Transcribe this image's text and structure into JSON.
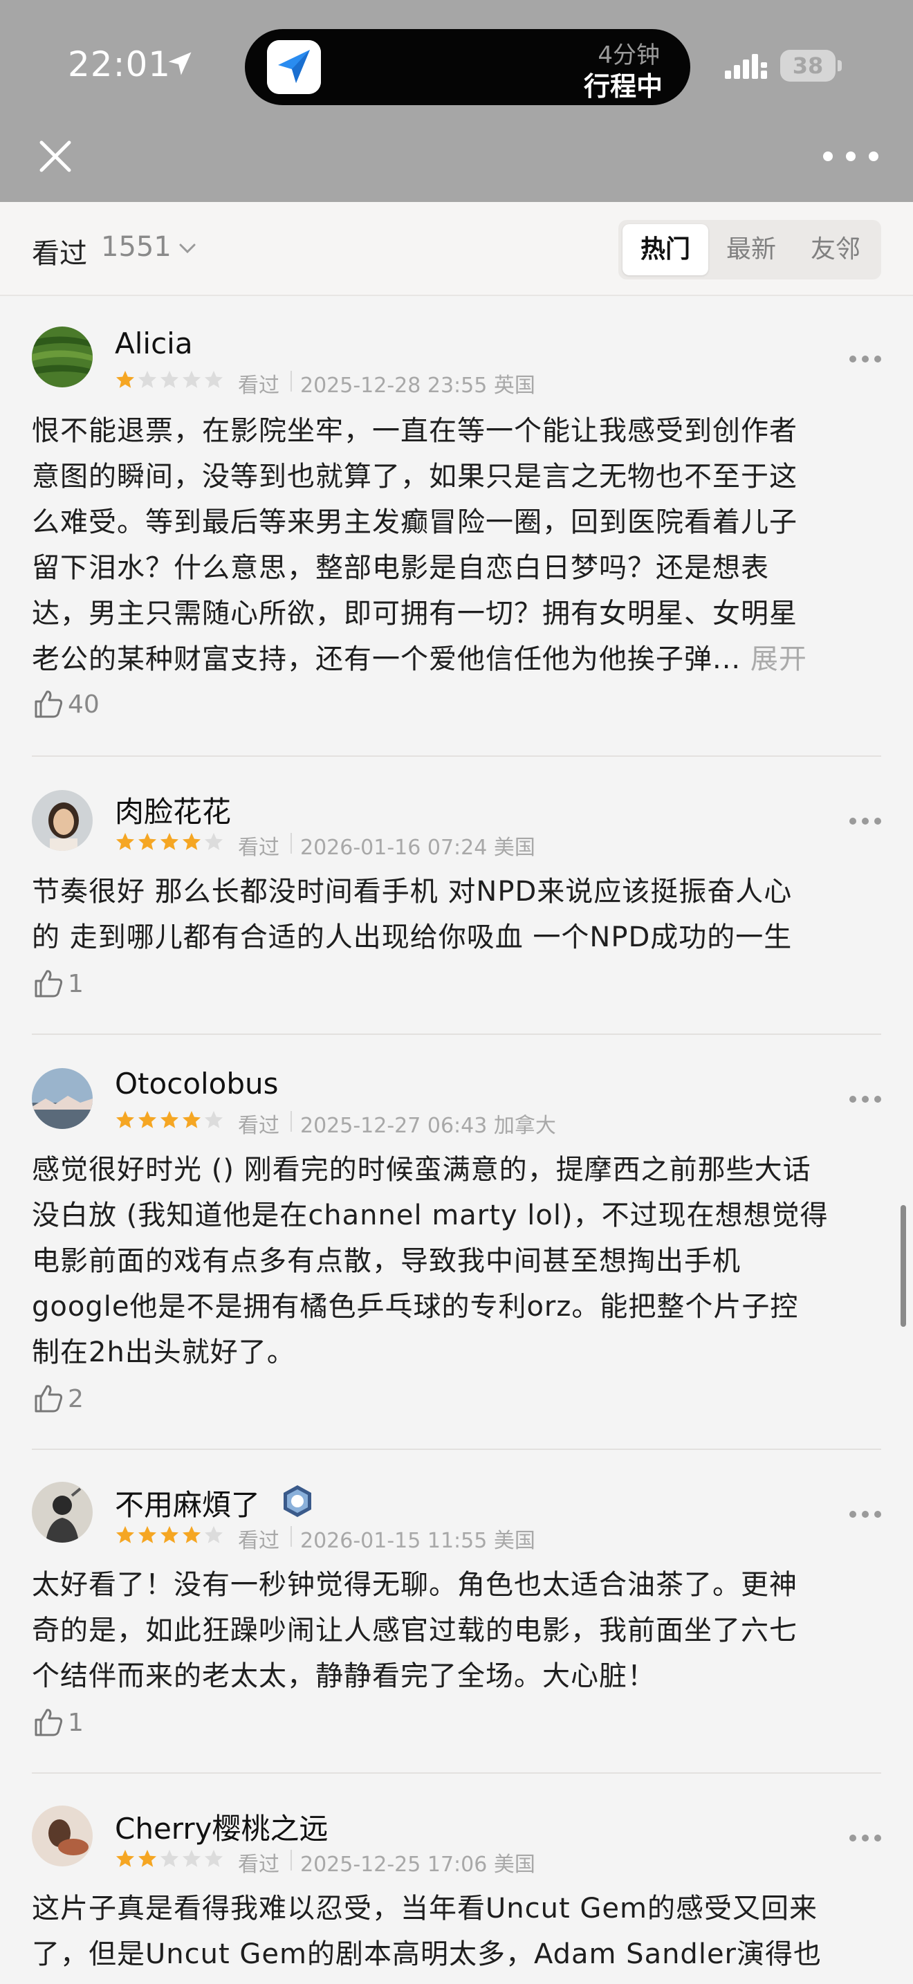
{
  "status_bar": {
    "time": "22:01",
    "island_line1": "4分钟",
    "island_line2": "行程中",
    "battery": "38"
  },
  "filter": {
    "seen_label": "看过",
    "seen_count": "1551",
    "tabs": [
      "热门",
      "最新",
      "友邻"
    ],
    "active_tab": "热门"
  },
  "reviews": [
    {
      "name": "Alicia",
      "rating": 1,
      "status": "看过",
      "date": "2025-12-28 23:55 英国",
      "lines": [
        "恨不能退票，在影院坐牢，一直在等一个能让我感受到创作者",
        "意图的瞬间，没等到也就算了，如果只是言之无物也不至于这",
        "么难受。等到最后等来男主发癫冒险一圈，回到医院看着儿子",
        "留下泪水？什么意思，整部电影是自恋白日梦吗？还是想表",
        "达，男主只需随心所欲，即可拥有一切？拥有女明星、女明星",
        "老公的某种财富支持，还有一个爱他信任他为他挨子弹..."
      ],
      "expand": "展开",
      "likes": "40"
    },
    {
      "name": "肉脸花花",
      "rating": 4,
      "status": "看过",
      "date": "2026-01-16 07:24 美国",
      "lines": [
        "节奏很好 那么长都没时间看手机 对NPD来说应该挺振奋人心",
        "的 走到哪儿都有合适的人出现给你吸血 一个NPD成功的一生"
      ],
      "likes": "1"
    },
    {
      "name": "Otocolobus",
      "rating": 4,
      "status": "看过",
      "date": "2025-12-27 06:43 加拿大",
      "lines": [
        "感觉很好时光 () 刚看完的时候蛮满意的，提摩西之前那些大话",
        "没白放 (我知道他是在channel marty lol)，不过现在想想觉得",
        "电影前面的戏有点多有点散，导致我中间甚至想掏出手机",
        "google他是不是拥有橘色乒乓球的专利orz。能把整个片子控",
        "制在2h出头就好了。"
      ],
      "likes": "2"
    },
    {
      "name": "不用麻煩了",
      "rating": 4,
      "status": "看过",
      "date": "2026-01-15 11:55 美国",
      "lines": [
        "太好看了！没有一秒钟觉得无聊。角色也太适合油茶了。更神",
        "奇的是，如此狂躁吵闹让人感官过载的电影，我前面坐了六七",
        "个结伴而来的老太太，静静看完了全场。大心脏！"
      ],
      "likes": "1"
    },
    {
      "name": "Cherry樱桃之远",
      "rating": 2,
      "status": "看过",
      "date": "2025-12-25 17:06 美国",
      "lines": [
        "这片子真是看得我难以忍受，当年看Uncut Gem的感受又回来",
        "了，但是Uncut Gem的剧本高明太多，Adam Sandler演得也"
      ]
    }
  ],
  "colors": {
    "star_on": "#f5a623",
    "star_off": "#dcdcdc",
    "header_dim": "#a6a6a6"
  }
}
